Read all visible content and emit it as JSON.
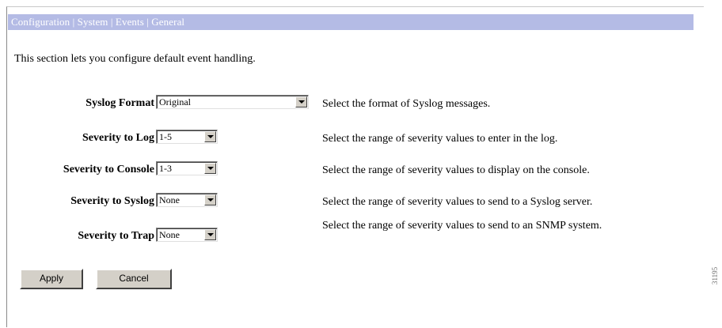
{
  "breadcrumb": "Configuration | System | Events | General",
  "intro_text": "This section lets you configure default event handling.",
  "fields": [
    {
      "label": "Syslog Format",
      "value": "Original",
      "help": "Select the format of Syslog messages."
    },
    {
      "label": "Severity to Log",
      "value": "1-5",
      "help": "Select the range of severity values to enter in the log."
    },
    {
      "label": "Severity to Console",
      "value": "1-3",
      "help": "Select the range of severity values to display on the console."
    },
    {
      "label": "Severity to Syslog",
      "value": "None",
      "help": "Select the range of severity values to send to a Syslog server."
    },
    {
      "label": "Severity to Trap",
      "value": "None",
      "help": "Select the range of severity values to send to an SNMP system."
    }
  ],
  "buttons": {
    "apply": "Apply",
    "cancel": "Cancel"
  },
  "figure_code": "31195",
  "colors": {
    "titlebar_bg": "#b4bbe5",
    "titlebar_text": "#ffffff",
    "button_face": "#d4d0c8"
  }
}
